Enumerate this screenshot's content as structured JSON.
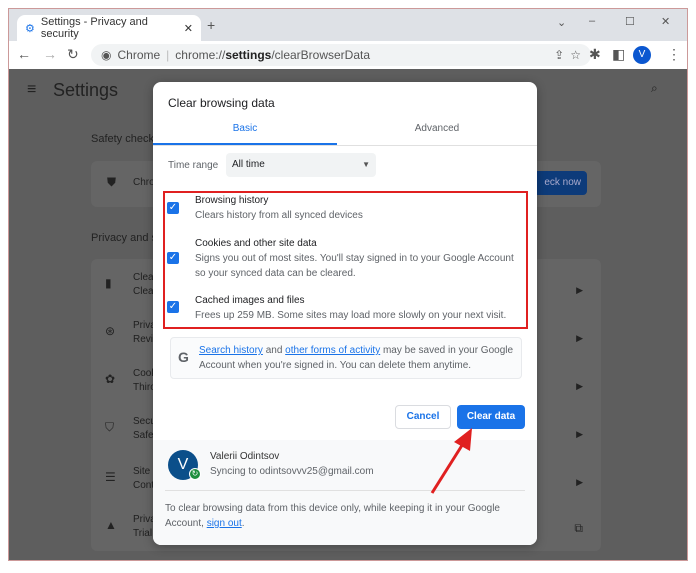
{
  "browser": {
    "tab_title": "Settings - Privacy and security",
    "site_label": "Chrome",
    "url_prefix": "chrome://",
    "url_bold": "settings",
    "url_suffix": "/clearBrowserData",
    "avatar_letter": "V"
  },
  "settings": {
    "title": "Settings",
    "safety_check_label": "Safety check",
    "safety_row": "Chro",
    "check_now_label": "eck now",
    "privacy_label": "Privacy and s",
    "rows": [
      {
        "title": "Clea",
        "sub": "Clea"
      },
      {
        "title": "Priva",
        "sub": "Revi"
      },
      {
        "title": "Cook",
        "sub": "Thiro"
      },
      {
        "title": "Secu",
        "sub": "Safe"
      },
      {
        "title": "Site",
        "sub": "Cont"
      },
      {
        "title": "Priva",
        "sub": "Trial"
      }
    ]
  },
  "dialog": {
    "title": "Clear browsing data",
    "tabs": [
      {
        "label": "Basic",
        "active": true
      },
      {
        "label": "Advanced",
        "active": false
      }
    ],
    "time_range_label": "Time range",
    "time_range_value": "All time",
    "items": [
      {
        "title": "Browsing history",
        "desc": "Clears history from all synced devices",
        "checked": true
      },
      {
        "title": "Cookies and other site data",
        "desc": "Signs you out of most sites. You'll stay signed in to your Google Account so your synced data can be cleared.",
        "checked": true
      },
      {
        "title": "Cached images and files",
        "desc": "Frees up 259 MB. Some sites may load more slowly on your next visit.",
        "checked": true
      }
    ],
    "google_note": {
      "link1": "Search history",
      "and": " and ",
      "link2": "other forms of activity",
      "rest": " may be saved in your Google Account when you're signed in. You can delete them anytime."
    },
    "cancel_label": "Cancel",
    "clear_label": "Clear data",
    "account": {
      "name": "Valerii Odintsov",
      "sync": "Syncing to odintsovvv25@gmail.com",
      "initial": "V"
    },
    "footer": {
      "text": "To clear browsing data from this device only, while keeping it in your Google Account, ",
      "link": "sign out",
      "end": "."
    }
  },
  "colors": {
    "accent": "#1a73e8",
    "highlight": "#e02020"
  }
}
